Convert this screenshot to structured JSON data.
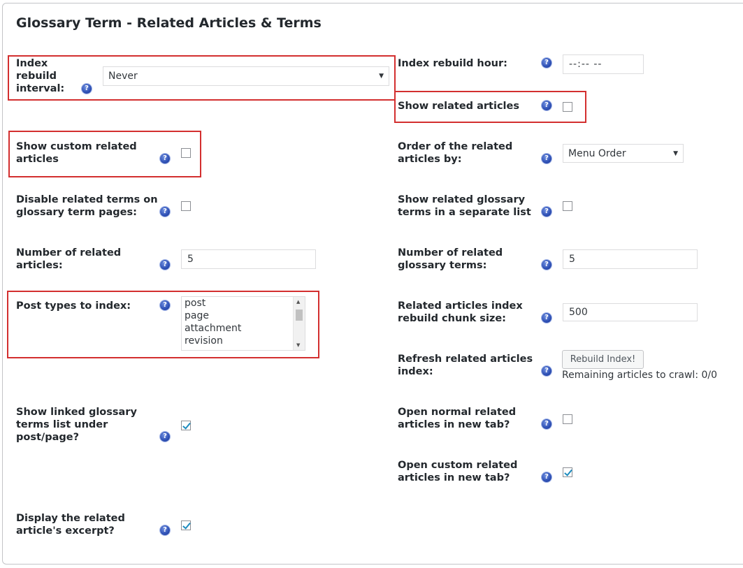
{
  "section": {
    "title": "Glossary Term - Related Articles & Terms"
  },
  "fields": {
    "index_rebuild_interval": {
      "label_lines": [
        "Index",
        "rebuild",
        "interval:"
      ],
      "value": "Never"
    },
    "index_rebuild_hour": {
      "label": "Index rebuild hour:",
      "value": "--:-- --"
    },
    "show_related_articles": {
      "label": "Show related articles",
      "checked": false
    },
    "show_custom_related": {
      "label_lines": [
        "Show custom related",
        "articles"
      ],
      "checked": false
    },
    "order_related_by": {
      "label_lines": [
        "Order of the related",
        "articles by:"
      ],
      "value": "Menu Order"
    },
    "disable_related_terms": {
      "label_lines": [
        "Disable related terms on",
        "glossary term pages:"
      ],
      "checked": false
    },
    "show_related_glossary_separate": {
      "label_lines": [
        "Show related glossary",
        "terms in a separate list"
      ],
      "checked": false
    },
    "number_related_articles": {
      "label_lines": [
        "Number of related",
        "articles:"
      ],
      "value": "5"
    },
    "number_related_terms": {
      "label_lines": [
        "Number of related",
        "glossary terms:"
      ],
      "value": "5"
    },
    "post_types_to_index": {
      "label": "Post types to index:",
      "options": [
        "post",
        "page",
        "attachment",
        "revision"
      ]
    },
    "rebuild_chunk_size": {
      "label_lines": [
        "Related articles index",
        "rebuild chunk size:"
      ],
      "value": "500"
    },
    "refresh_related_index": {
      "label_lines": [
        "Refresh related articles",
        "index:"
      ],
      "button": "Rebuild Index!",
      "note": "Remaining articles to crawl: 0/0"
    },
    "show_linked_glossary": {
      "label_lines": [
        "Show linked glossary",
        "terms list under",
        "post/page?"
      ],
      "checked": true
    },
    "open_normal_new_tab": {
      "label_lines": [
        "Open normal related",
        "articles in new tab?"
      ],
      "checked": false
    },
    "open_custom_new_tab": {
      "label_lines": [
        "Open custom related",
        "articles in new tab?"
      ],
      "checked": true
    },
    "display_excerpt": {
      "label_lines": [
        "Display the related",
        "article's excerpt?"
      ],
      "checked": true
    }
  },
  "help_icon_glyph": "?"
}
